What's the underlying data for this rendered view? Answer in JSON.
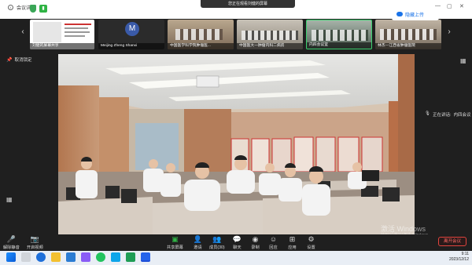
{
  "topbar": {
    "meeting_info_label": "会议详情",
    "banner_text": "您正在观看刘健的屏幕",
    "minimize": "—",
    "restore": "▢",
    "close": "✕"
  },
  "upload_button_label": "隐藏上传",
  "participants": [
    {
      "name": "刘健的屏幕共享"
    },
    {
      "name": "Meijing Zheng Shanxi",
      "avatar_letter": "M"
    },
    {
      "name": "中国医学科学院肿瘤医..."
    },
    {
      "name": "中国医大一肿瘤内科二病房"
    },
    {
      "name": "内四会议室"
    },
    {
      "name": "林杰—江西省肿瘤医院"
    }
  ],
  "left_controls": {
    "cancel_pin_label": "取消锁定"
  },
  "speaking": {
    "label": "正在讲话:",
    "name": "内四会议"
  },
  "toolbar": {
    "mute_label": "解除静音",
    "video_label": "开启视频",
    "share_label": "共享屏幕",
    "invite_label": "邀请",
    "members_label": "成员(30)",
    "chat_label": "聊天",
    "record_label": "录制",
    "reaction_label": "回应",
    "apps_label": "应用",
    "settings_label": "设置",
    "leave_label": "离开会议"
  },
  "watermark": {
    "line1": "激活 Windows",
    "line2": "转到\"设置\"以激活 Windows。"
  },
  "taskbar": {
    "time": "9:11",
    "date": "2023/12/12"
  }
}
